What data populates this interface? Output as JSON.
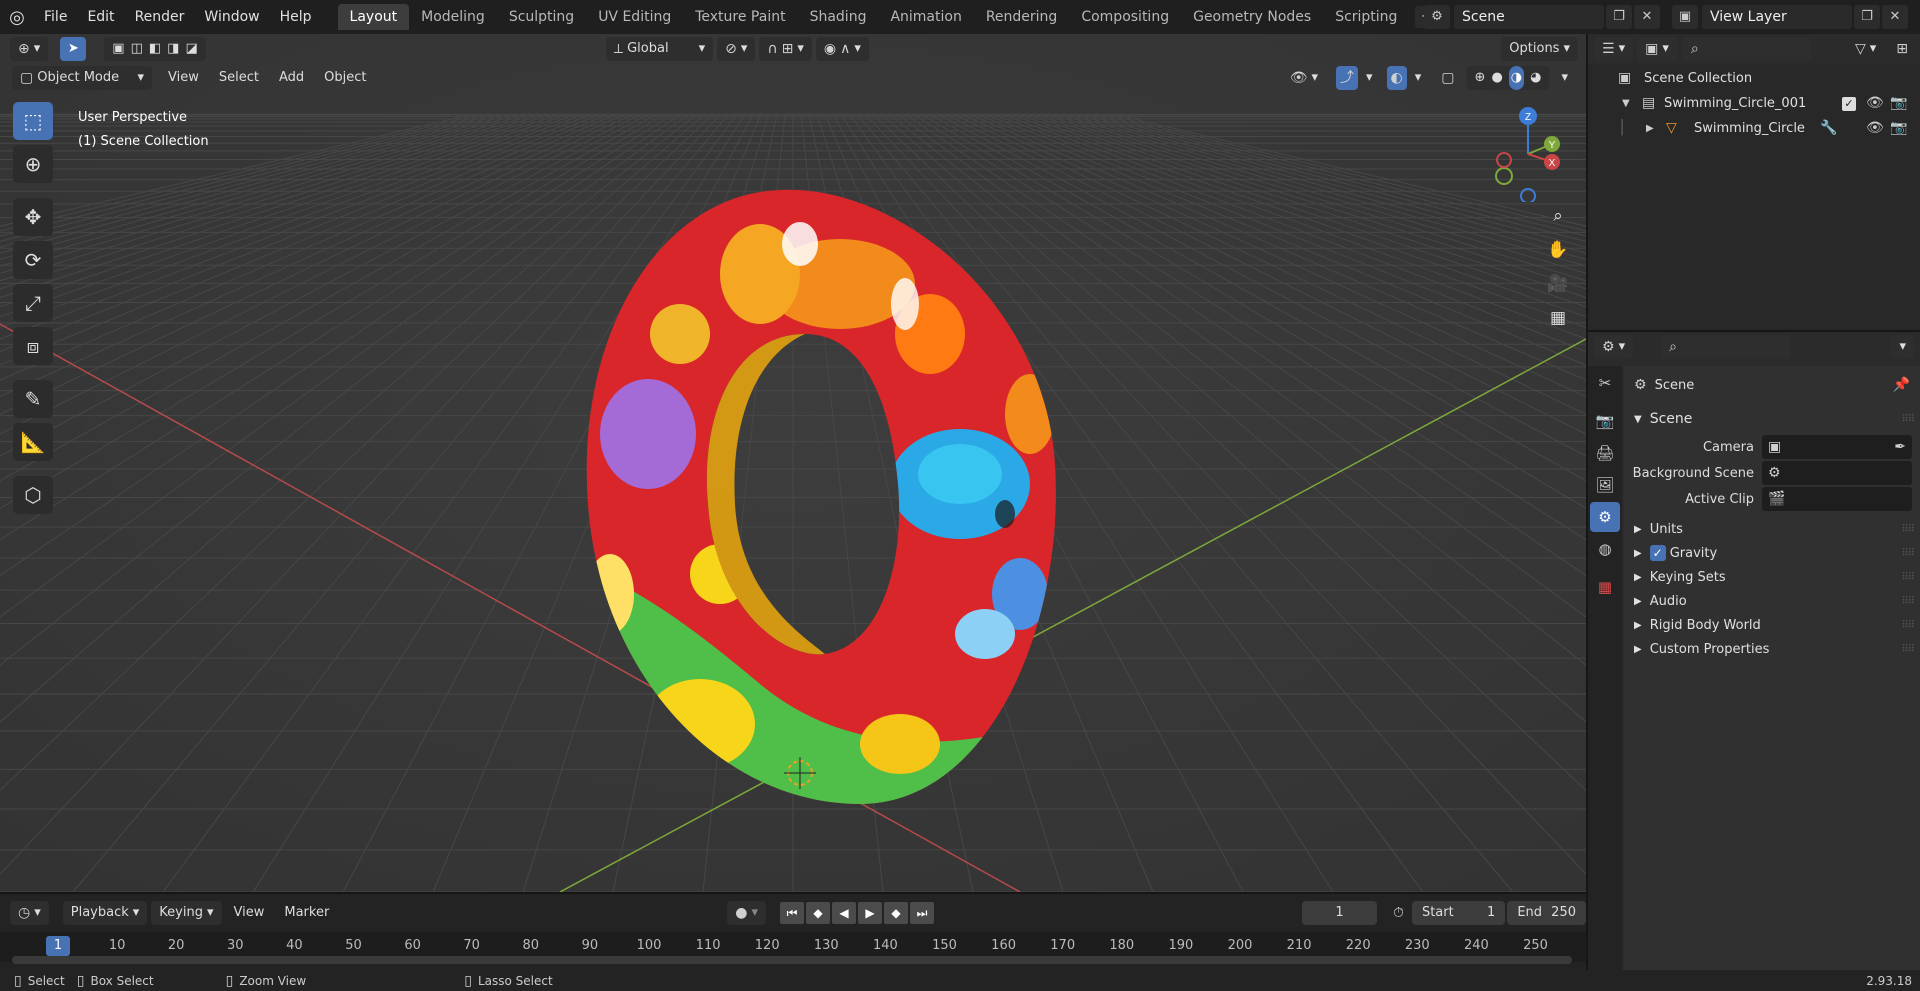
{
  "menus": [
    "File",
    "Edit",
    "Render",
    "Window",
    "Help"
  ],
  "workspaces": [
    "Layout",
    "Modeling",
    "Sculpting",
    "UV Editing",
    "Texture Paint",
    "Shading",
    "Animation",
    "Rendering",
    "Compositing",
    "Geometry Nodes",
    "Scripting"
  ],
  "active_workspace": "Layout",
  "scene_name": "Scene",
  "view_layer": "View Layer",
  "viewport": {
    "transform_orientation": "Global",
    "options_label": "Options",
    "mode": "Object Mode",
    "menu": [
      "View",
      "Select",
      "Add",
      "Object"
    ],
    "info_line1": "User Perspective",
    "info_line2": "(1) Scene Collection",
    "gizmo_axes": {
      "z": "Z",
      "y": "Y",
      "x": "X"
    }
  },
  "outliner": {
    "root": "Scene Collection",
    "collection": "Swimming_Circle_001",
    "object": "Swimming_Circle"
  },
  "properties": {
    "context_title": "Scene",
    "panel_title": "Scene",
    "camera_label": "Camera",
    "background_scene_label": "Background Scene",
    "active_clip_label": "Active Clip",
    "subpanels": [
      "Units",
      "Gravity",
      "Keying Sets",
      "Audio",
      "Rigid Body World",
      "Custom Properties"
    ],
    "gravity_checked": true
  },
  "timeline": {
    "menus": [
      "Playback",
      "Keying",
      "View",
      "Marker"
    ],
    "current_frame": "1",
    "start_label": "Start",
    "start_value": "1",
    "end_label": "End",
    "end_value": "250",
    "ruler_current": "1",
    "ruler_ticks": [
      "10",
      "20",
      "30",
      "40",
      "50",
      "60",
      "70",
      "80",
      "90",
      "100",
      "110",
      "120",
      "130",
      "140",
      "150",
      "160",
      "170",
      "180",
      "190",
      "200",
      "210",
      "220",
      "230",
      "240",
      "250"
    ]
  },
  "statusbar": {
    "select": "Select",
    "box_select": "Box Select",
    "zoom_view": "Zoom View",
    "lasso_select": "Lasso Select",
    "version": "2.93.18"
  },
  "colors": {
    "accent": "#4772b3",
    "x_axis": "#c84646",
    "y_axis": "#7fa83a",
    "z_axis": "#3d7dd8",
    "viewport_bg": "#393939"
  },
  "icons": [
    "blender-logo",
    "cursor-icon",
    "move-icon",
    "rotate-icon",
    "scale-icon",
    "transform-icon",
    "annotate-icon",
    "measure-icon",
    "add-cube-icon",
    "zoom-icon",
    "hand-icon",
    "camera-icon",
    "grid-icon",
    "eye-icon",
    "camera-render-icon",
    "wrench-icon",
    "scene-icon",
    "world-icon"
  ]
}
